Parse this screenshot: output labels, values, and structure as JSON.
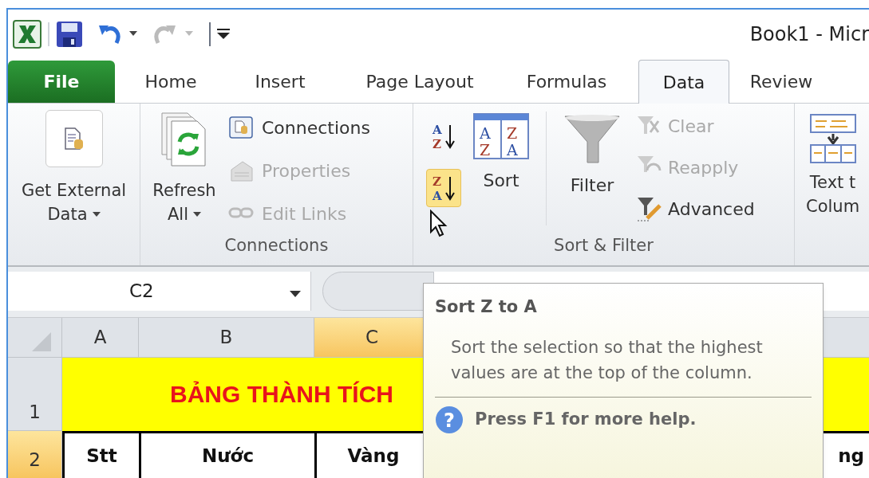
{
  "window": {
    "title": "Book1 - Micr"
  },
  "tabs": [
    {
      "label": "File",
      "kind": "file",
      "selected": false
    },
    {
      "label": "Home",
      "kind": "tab",
      "selected": false
    },
    {
      "label": "Insert",
      "kind": "tab",
      "selected": false
    },
    {
      "label": "Page Layout",
      "kind": "tab",
      "selected": false
    },
    {
      "label": "Formulas",
      "kind": "tab",
      "selected": false
    },
    {
      "label": "Data",
      "kind": "tab",
      "selected": true
    },
    {
      "label": "Review",
      "kind": "tab",
      "selected": false
    }
  ],
  "ribbon": {
    "get_external_data": {
      "lines": [
        "Get External",
        "Data"
      ]
    },
    "connections": {
      "title": "Connections",
      "refresh": {
        "lines": [
          "Refresh",
          "All"
        ]
      },
      "small_buttons": [
        {
          "label": "Connections",
          "disabled": false
        },
        {
          "label": "Properties",
          "disabled": true
        },
        {
          "label": "Edit Links",
          "disabled": true
        }
      ]
    },
    "sort_filter": {
      "title": "Sort & Filter",
      "sort_za_hovered": true,
      "sort_az_glyphs": [
        "A",
        "Z"
      ],
      "sort_za_glyphs": [
        "Z",
        "A"
      ],
      "sort_dialog_glyphs": [
        "A",
        "Z",
        "Z",
        "A"
      ],
      "sort": {
        "label": "Sort"
      },
      "filter": {
        "label": "Filter"
      },
      "small_buttons": [
        {
          "label": "Clear",
          "disabled": true
        },
        {
          "label": "Reapply",
          "disabled": true
        },
        {
          "label": "Advanced",
          "disabled": false
        }
      ]
    },
    "data_tools": {
      "lines": [
        "Text t",
        "Colum"
      ]
    }
  },
  "formula_bar": {
    "name_box": "C2"
  },
  "sheet": {
    "columns": [
      {
        "label": "A",
        "selected": false
      },
      {
        "label": "B",
        "selected": false
      },
      {
        "label": "C",
        "selected": true
      }
    ],
    "rows": [
      {
        "header": "1",
        "selected": false,
        "title": "BẢNG THÀNH TÍCH"
      },
      {
        "header": "2",
        "selected": true,
        "cells": [
          "Stt",
          "Nước",
          "Vàng"
        ],
        "cell_right": "ng"
      }
    ]
  },
  "tooltip": {
    "title": "Sort Z to A",
    "body": "Sort the selection so that the highest values are at the top of the column.",
    "help_glyph": "?",
    "help": "Press F1 for more help."
  }
}
